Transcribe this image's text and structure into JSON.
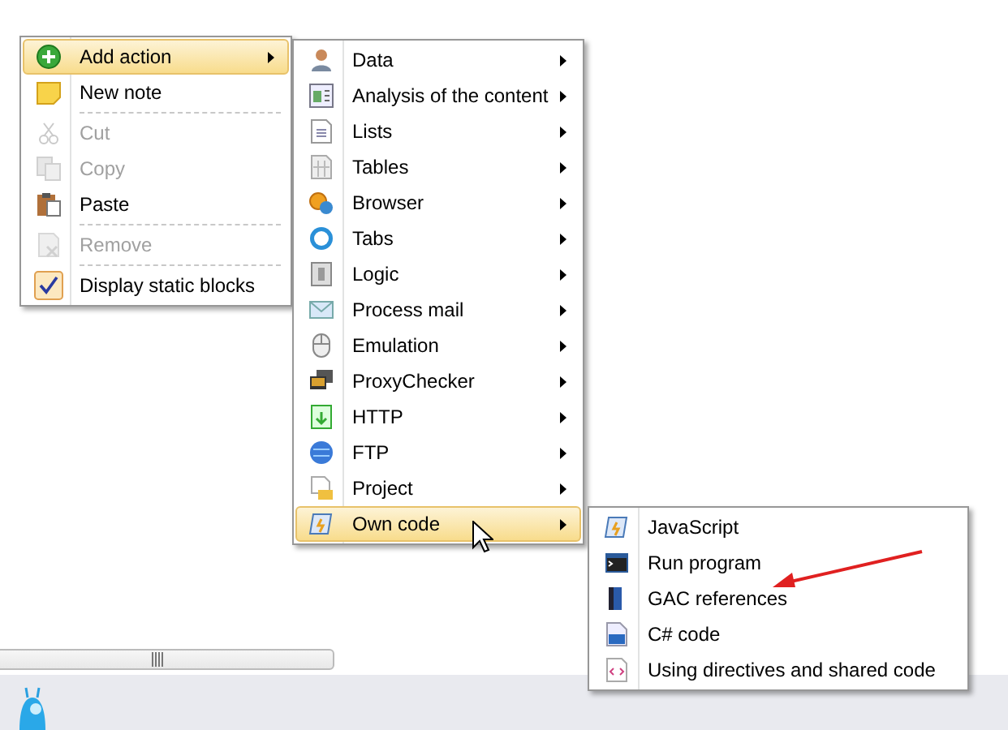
{
  "menus": [
    {
      "items": [
        {
          "label": "Add action",
          "kind": "command",
          "selected": true,
          "disabled": false,
          "submenu": true,
          "separator_after": false
        },
        {
          "label": "New note",
          "kind": "command",
          "selected": false,
          "disabled": false,
          "submenu": false,
          "separator_after": true
        },
        {
          "label": "Cut",
          "kind": "command",
          "selected": false,
          "disabled": true,
          "submenu": false,
          "separator_after": false
        },
        {
          "label": "Copy",
          "kind": "command",
          "selected": false,
          "disabled": true,
          "submenu": false,
          "separator_after": false
        },
        {
          "label": "Paste",
          "kind": "command",
          "selected": false,
          "disabled": false,
          "submenu": false,
          "separator_after": true
        },
        {
          "label": "Remove",
          "kind": "command",
          "selected": false,
          "disabled": true,
          "submenu": false,
          "separator_after": true
        },
        {
          "label": "Display static blocks",
          "kind": "checkbox",
          "checked": true,
          "selected": false,
          "disabled": false,
          "submenu": false,
          "separator_after": false
        }
      ]
    },
    {
      "items": [
        {
          "label": "Data",
          "kind": "command",
          "selected": false,
          "disabled": false,
          "submenu": true,
          "separator_after": false
        },
        {
          "label": "Analysis of the content",
          "kind": "command",
          "selected": false,
          "disabled": false,
          "submenu": true,
          "separator_after": false
        },
        {
          "label": "Lists",
          "kind": "command",
          "selected": false,
          "disabled": false,
          "submenu": true,
          "separator_after": false
        },
        {
          "label": "Tables",
          "kind": "command",
          "selected": false,
          "disabled": false,
          "submenu": true,
          "separator_after": false
        },
        {
          "label": "Browser",
          "kind": "command",
          "selected": false,
          "disabled": false,
          "submenu": true,
          "separator_after": false
        },
        {
          "label": "Tabs",
          "kind": "command",
          "selected": false,
          "disabled": false,
          "submenu": true,
          "separator_after": false
        },
        {
          "label": "Logic",
          "kind": "command",
          "selected": false,
          "disabled": false,
          "submenu": true,
          "separator_after": false
        },
        {
          "label": "Process mail",
          "kind": "command",
          "selected": false,
          "disabled": false,
          "submenu": true,
          "separator_after": false
        },
        {
          "label": "Emulation",
          "kind": "command",
          "selected": false,
          "disabled": false,
          "submenu": true,
          "separator_after": false
        },
        {
          "label": "ProxyChecker",
          "kind": "command",
          "selected": false,
          "disabled": false,
          "submenu": true,
          "separator_after": false
        },
        {
          "label": "HTTP",
          "kind": "command",
          "selected": false,
          "disabled": false,
          "submenu": true,
          "separator_after": false
        },
        {
          "label": "FTP",
          "kind": "command",
          "selected": false,
          "disabled": false,
          "submenu": true,
          "separator_after": false
        },
        {
          "label": "Project",
          "kind": "command",
          "selected": false,
          "disabled": false,
          "submenu": true,
          "separator_after": false
        },
        {
          "label": "Own code",
          "kind": "command",
          "selected": true,
          "disabled": false,
          "submenu": true,
          "separator_after": false
        }
      ]
    },
    {
      "items": [
        {
          "label": "JavaScript",
          "kind": "command",
          "selected": false,
          "disabled": false,
          "submenu": false,
          "separator_after": false
        },
        {
          "label": "Run program",
          "kind": "command",
          "selected": false,
          "disabled": false,
          "submenu": false,
          "separator_after": false
        },
        {
          "label": "GAC references",
          "kind": "command",
          "selected": false,
          "disabled": false,
          "submenu": false,
          "separator_after": false
        },
        {
          "label": "C# code",
          "kind": "command",
          "selected": false,
          "disabled": false,
          "submenu": false,
          "separator_after": false
        },
        {
          "label": "Using directives and shared code",
          "kind": "command",
          "selected": false,
          "disabled": false,
          "submenu": false,
          "separator_after": false
        }
      ]
    }
  ]
}
